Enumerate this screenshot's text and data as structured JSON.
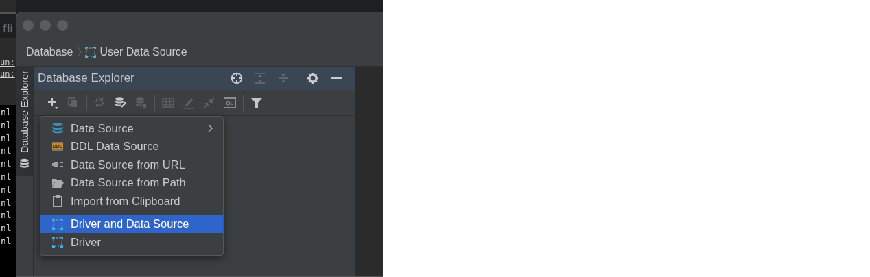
{
  "terminal": {
    "title": "fli",
    "links": [
      "un:",
      "un:"
    ],
    "lines": [
      "nl",
      "nl",
      "nl",
      "nl",
      "nl",
      "nl",
      "nl",
      "nl",
      "nl",
      "nl",
      "nl"
    ]
  },
  "breadcrumb": [
    {
      "label": "Database",
      "kind": "text"
    },
    {
      "label": "User Data Source",
      "kind": "driver"
    }
  ],
  "side_tab": {
    "label": "Database Explorer",
    "selected": true
  },
  "tool_window": {
    "title": "Database Explorer",
    "actions": [
      [
        {
          "kind": "target",
          "disabled": false
        },
        {
          "kind": "expand",
          "disabled": true
        },
        {
          "kind": "collapse",
          "disabled": true
        }
      ],
      [
        {
          "kind": "gear",
          "disabled": false
        },
        {
          "kind": "minimize",
          "disabled": false
        }
      ]
    ],
    "toolbar": [
      [
        {
          "kind": "plus",
          "disabled": false
        },
        {
          "kind": "copy",
          "disabled": true
        }
      ],
      [
        {
          "kind": "refresh",
          "disabled": true
        },
        {
          "kind": "db-wrench",
          "disabled": false
        },
        {
          "kind": "db-stop",
          "disabled": true
        }
      ],
      [
        {
          "kind": "table",
          "disabled": true
        },
        {
          "kind": "pencil",
          "disabled": true
        },
        {
          "kind": "jump",
          "disabled": true
        },
        {
          "kind": "ql",
          "disabled": true,
          "text": "QL"
        }
      ],
      [
        {
          "kind": "filter",
          "disabled": false
        }
      ]
    ]
  },
  "menu": {
    "sections": [
      {
        "items": [
          {
            "label": "Data Source",
            "kind": "database",
            "submenu": true,
            "selected": false
          },
          {
            "label": "DDL Data Source",
            "kind": "ddl",
            "icon_text": "DDL",
            "submenu": false,
            "selected": false
          },
          {
            "label": "Data Source from URL",
            "kind": "plug",
            "submenu": false,
            "selected": false
          },
          {
            "label": "Data Source from Path",
            "kind": "folder",
            "submenu": false,
            "selected": false
          },
          {
            "label": "Import from Clipboard",
            "kind": "clipboard",
            "submenu": false,
            "selected": false
          }
        ]
      },
      {
        "items": [
          {
            "label": "Driver and Data Source",
            "kind": "driver",
            "submenu": false,
            "selected": true
          },
          {
            "label": "Driver",
            "kind": "driver",
            "submenu": false,
            "selected": false
          }
        ]
      }
    ]
  }
}
